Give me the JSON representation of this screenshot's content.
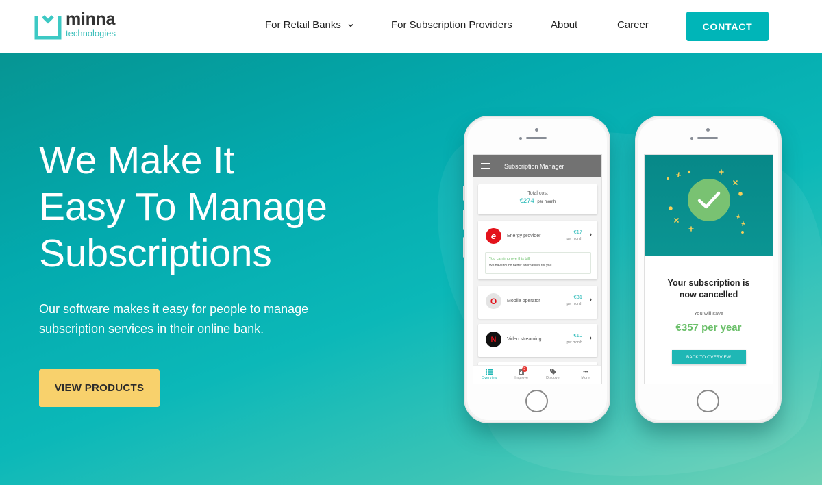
{
  "header": {
    "logo": {
      "name": "minna",
      "subtitle": "technologies"
    },
    "nav": [
      {
        "label": "For Retail Banks",
        "has_dropdown": true
      },
      {
        "label": "For Subscription Providers",
        "has_dropdown": false
      },
      {
        "label": "About",
        "has_dropdown": false
      },
      {
        "label": "Career",
        "has_dropdown": false
      }
    ],
    "contact_label": "CONTACT"
  },
  "hero": {
    "title_lines": [
      "We Make It",
      "Easy To Manage",
      "Subscriptions"
    ],
    "description": "Our software makes it easy for people to manage subscription services in their online bank.",
    "cta_label": "VIEW PRODUCTS"
  },
  "phone_left": {
    "app_title": "Subscription Manager",
    "total": {
      "label": "Total cost",
      "amount": "€274",
      "period": "per month"
    },
    "subscriptions": [
      {
        "name": "Energy provider",
        "price": "€17",
        "period": "per month",
        "icon": "e",
        "icon_bg": "#e3121b",
        "tip": {
          "headline": "You can improve this bill",
          "text": "We have found better alternatives for you"
        }
      },
      {
        "name": "Mobile operator",
        "price": "€31",
        "period": "per month",
        "icon": "O",
        "icon_bg": "#e4e4e4"
      },
      {
        "name": "Video streaming",
        "price": "€10",
        "period": "per month",
        "icon": "N",
        "icon_bg": "#111111"
      }
    ],
    "tabs": [
      {
        "label": "Overview",
        "active": true
      },
      {
        "label": "Improve",
        "badge": "2"
      },
      {
        "label": "Discover"
      },
      {
        "label": "More"
      }
    ]
  },
  "phone_right": {
    "title": "Your subscription is now cancelled",
    "save_label": "You will save",
    "save_amount": "€357 per year",
    "button_label": "BACK TO OVERVIEW"
  },
  "colors": {
    "brand_teal": "#00b5b8",
    "cta_yellow": "#f8d16c",
    "success_green": "#6abf69"
  }
}
